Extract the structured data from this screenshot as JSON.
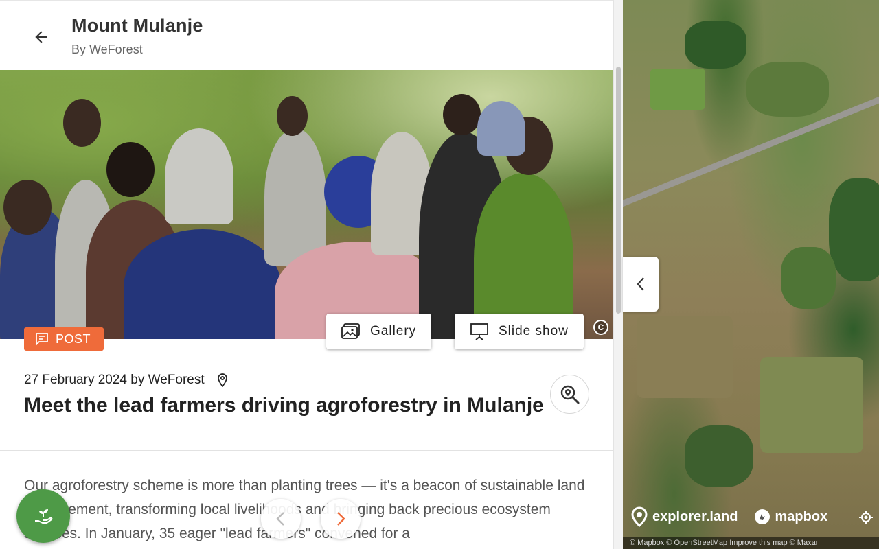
{
  "header": {
    "title": "Mount Mulanje",
    "subtitle": "By WeForest"
  },
  "hero": {
    "gallery_label": "Gallery",
    "slideshow_label": "Slide show",
    "copyright_symbol": "C"
  },
  "post": {
    "badge_label": "POST",
    "meta": "27 February 2024 by WeForest",
    "headline": "Meet the lead farmers driving agroforestry in Mulanje",
    "body": "Our agroforestry scheme is more than planting trees — it's a beacon of sustainable land management, transforming local livelihoods and bringing back precious ecosystem services. In January, 35 eager \"lead farmers\" convened for a"
  },
  "map": {
    "brand_explorer": "explorer.land",
    "brand_mapbox": "mapbox",
    "attribution": "© Mapbox © OpenStreetMap Improve this map © Maxar"
  },
  "colors": {
    "accent_orange": "#ef6b3a",
    "fab_green": "#4e9a47"
  },
  "icons": [
    "arrow-left-icon",
    "image-gallery-icon",
    "presentation-icon",
    "post-icon",
    "location-pin-icon",
    "search-zoom-icon",
    "plant-hand-icon",
    "chevron-left-icon",
    "chevron-right-icon",
    "explorer-pin-icon",
    "mapbox-logo-icon",
    "locate-icon"
  ]
}
